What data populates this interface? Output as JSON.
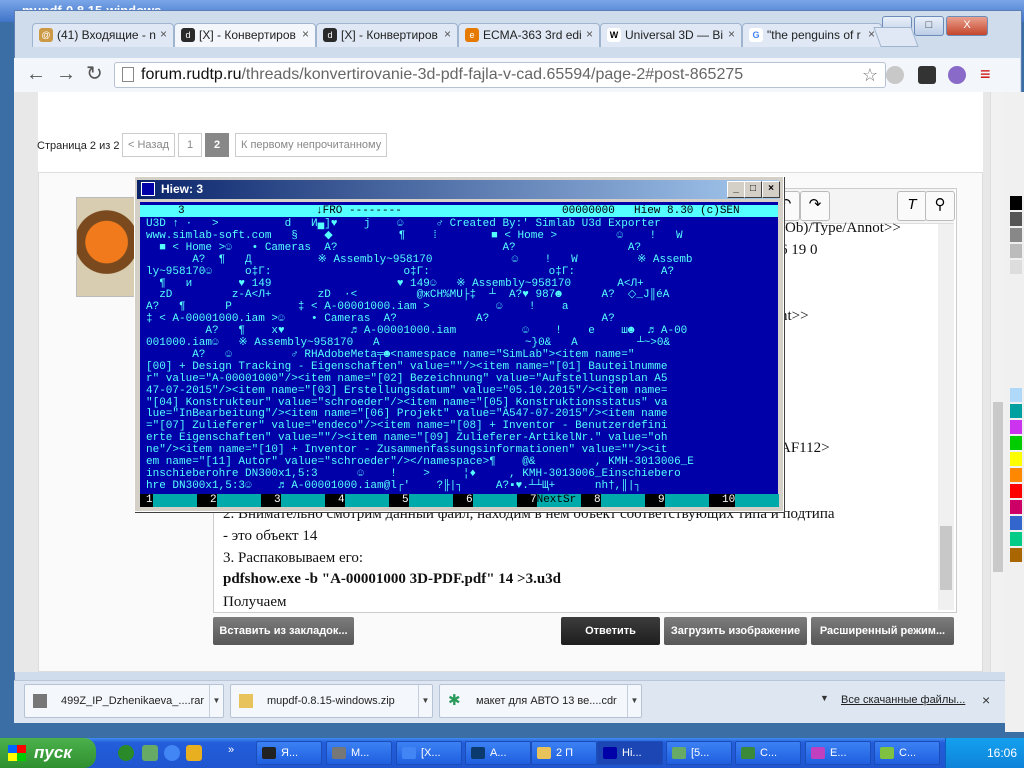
{
  "background_window": {
    "title": "mupdf-0.8.15-windows"
  },
  "browser": {
    "tabs": [
      {
        "label": "(41) Входящие - n",
        "icon": "mail-icon",
        "color": "#c94"
      },
      {
        "label": "[X] - Конвертиров",
        "icon": "rudtp-icon",
        "color": "#2a2a2a"
      },
      {
        "label": "[X] - Конвертиров",
        "icon": "rudtp-icon",
        "color": "#2a2a2a"
      },
      {
        "label": "ECMA-363 3rd edi",
        "icon": "ecma-icon",
        "color": "#e67a00"
      },
      {
        "label": "Universal 3D — Bi",
        "icon": "wikipedia-icon",
        "color": "#eee"
      },
      {
        "label": "\"the penguins of r",
        "icon": "google-icon",
        "color": "#4285f4"
      }
    ],
    "url_domain": "forum.rudtp.ru",
    "url_path": "/threads/konvertirovanie-3d-pdf-fajla-v-cad.65594/page-2#post-865275",
    "window_buttons": [
      "_",
      "□",
      "X"
    ]
  },
  "forum": {
    "pager_text": "Страница 2 из 2",
    "pager_prev": "< Назад",
    "pages": [
      "1",
      "2"
    ],
    "pager_first_unread": "К первому непрочитанному",
    "editor_side_lines": [
      "(Ob)/Type/Annot>>",
      "6 19 0",
      "nt>>",
      "AF112>"
    ],
    "editor_lines": [
      "2. Внимательно смотрим данный файл, находим в нем объект соответствующих типа и подтипа",
      "- это объект 14",
      "3. Распаковываем его:",
      "pdfshow.exe -b \"A-00001000 3D-PDF.pdf\"  14 >3.u3d",
      "Получаем"
    ],
    "buttons": {
      "insert_bookmark": "Вставить из закладок...",
      "reply": "Ответить",
      "upload_image": "Загрузить изображение",
      "advanced": "Расширенный режим..."
    }
  },
  "hiew": {
    "title": "Hiew: 3",
    "status": {
      "block": "3",
      "mode": "↓FRO --------",
      "offset": "00000000",
      "version": "Hiew 8.30 (c)SEN"
    },
    "lines": [
      "U3D ↑ ·   >          d   И▄]♥    j    ☺     ♂ Created By:' Simlab U3d Exporter",
      "www.simlab-soft.com   §    ◆          ¶    ⁞        ■ < Home >         ☺    !   W",
      "  ■ < Home >☺   • Cameras  A?                         A?                 A?",
      "       A?  ¶   Д          ※ Assembly~958170            ☺    !   W         ※ Assemb",
      "ly~958170☺     o‡Г:                    o‡Г:                  o‡Г:             A?",
      "  ¶   и       ♥ 149                   ♥ 149☺   ※ Assembly~958170       A<Л+",
      "  zD         z-A<Л+       zD  ·<         @жCH%MU├‡  ┴  A?♥ 987☻      A?  ◇_J║éA",
      "A?   ¶      P          ‡ < A-00001000.iam >          ☺    !    a",
      "‡ < A-00001000.iam >☺    • Cameras  A?            A?                 A?",
      "         A?   ¶    x♥          ♬ A-00001000.iam          ☺    !    e    ш☻  ♬ A-00",
      "001000.iam☺   ※ Assembly~958170   A                      ~}0&   A         ┴~>0&",
      "       A?   ☺         ♂ RHAdobeMeta╤☻<namespace name=\"SimLab\"><item name=\"",
      "[00] + Design Tracking - Eigenschaften\" value=\"\"/><item name=\"[01] Bauteilnumme",
      "r\" value=\"A-00001000\"/><item name=\"[02] Bezeichnung\" value=\"Aufstellungsplan A5",
      "47-07-2015\"/><item name=\"[03] Erstellungsdatum\" value=\"05.10.2015\"/><item name=",
      "\"[04] Konstrukteur\" value=\"schroeder\"/><item name=\"[05] Konstruktionsstatus\" va",
      "lue=\"InBearbeitung\"/><item name=\"[06] Projekt\" value=\"A547-07-2015\"/><item name",
      "=\"[07] Zulieferer\" value=\"endeco\"/><item name=\"[08] + Inventor - Benutzerdefini",
      "erte Eigenschaften\" value=\"\"/><item name=\"[09] Zulieferer-ArtikelNr.\" value=\"oh",
      "ne\"/><item name=\"[10] + Inventor - Zusammenfassungsinformationen\" value=\"\"/><it",
      "em name=\"[11] Autor\" value=\"schroeder\"/></namespace>¶    @&         , KMH-3013006_E",
      "inschieberohre DN300x1,5:3      ☺    !    >     ¦♦     , KMH-3013006_Einschiebero",
      "hre DN300x1,5:3☺    ♬ A-00001000.iam@l┌'    ?╟|┐     A?▪♥.┴┴Щ+      nh†,║|┐  "
    ],
    "fkeys": [
      {
        "n": "1",
        "l": ""
      },
      {
        "n": "2",
        "l": ""
      },
      {
        "n": "3",
        "l": ""
      },
      {
        "n": "4",
        "l": ""
      },
      {
        "n": "5",
        "l": ""
      },
      {
        "n": "6",
        "l": ""
      },
      {
        "n": "7",
        "l": "NextSr"
      },
      {
        "n": "8",
        "l": ""
      },
      {
        "n": "9",
        "l": ""
      },
      {
        "n": "10",
        "l": ""
      }
    ]
  },
  "downloads": {
    "items": [
      {
        "name": "499Z_IP_Dzhenikaeva_....rar",
        "icon": "archive-icon"
      },
      {
        "name": "mupdf-0.8.15-windows.zip",
        "icon": "zip-folder-icon"
      },
      {
        "name": "макет для АВТО 13 ве....cdr",
        "icon": "coreldraw-icon"
      }
    ],
    "all_downloads": "Все скачанные файлы..."
  },
  "taskbar": {
    "start": "пуск",
    "buttons": [
      {
        "label": "Я...",
        "color": "#222"
      },
      {
        "label": "М...",
        "color": "#777"
      },
      {
        "label": "[X...",
        "color": "#4285f4"
      },
      {
        "label": "A...",
        "color": "#0a3a6e"
      },
      {
        "label": "2 П",
        "color": "#e8c25b"
      },
      {
        "label": "Hi...",
        "color": "#0000a8"
      },
      {
        "label": "[5...",
        "color": "#6a6"
      },
      {
        "label": "C...",
        "color": "#3a8a3a"
      },
      {
        "label": "E...",
        "color": "#c040c0"
      },
      {
        "label": "C...",
        "color": "#7fc241"
      }
    ],
    "clock": "16:06"
  }
}
